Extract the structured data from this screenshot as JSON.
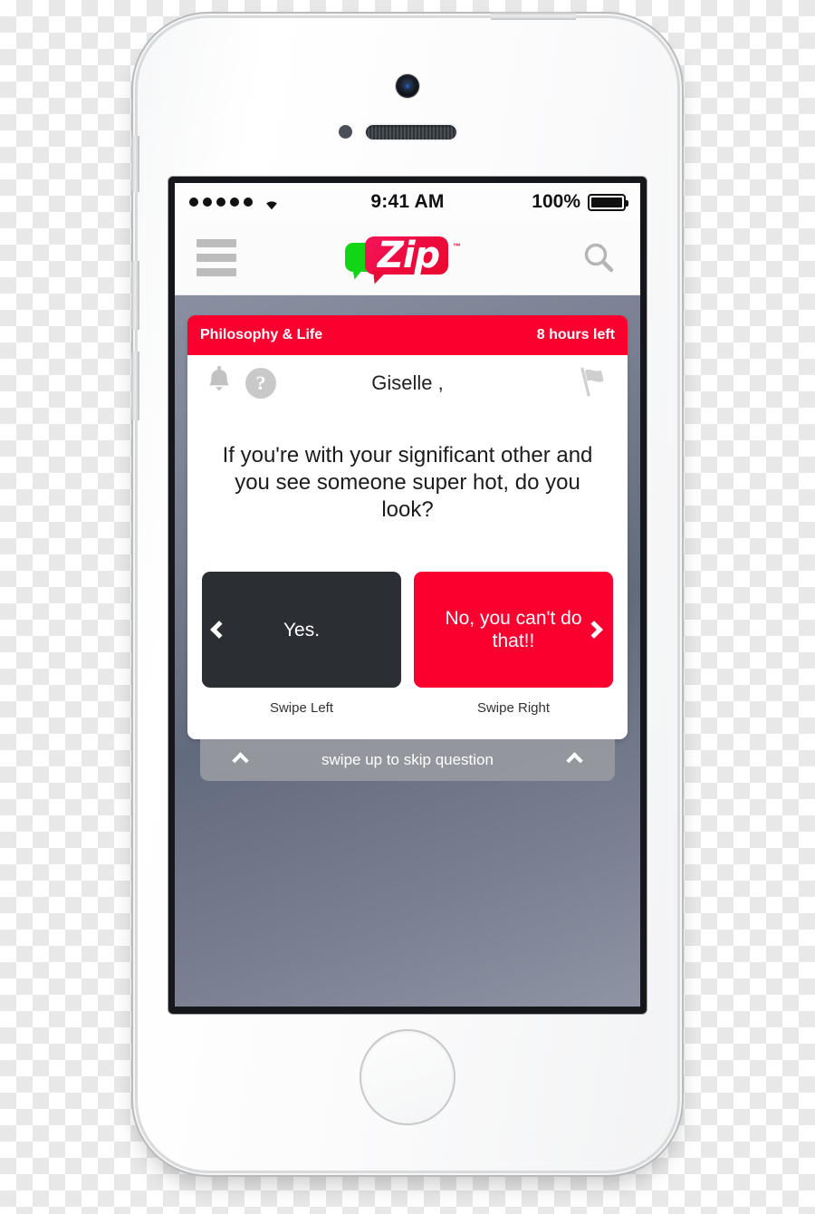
{
  "device": {
    "name": "iphone-5s-white",
    "icons": {
      "camera": "front-camera",
      "sensor": "proximity-sensor",
      "speaker": "earpiece-speaker",
      "home": "home-button",
      "power": "power-button",
      "mute": "mute-switch",
      "volume_up": "volume-up-button",
      "volume_down": "volume-down-button"
    }
  },
  "status_bar": {
    "signal_dots": 5,
    "wifi_icon": "wifi-icon",
    "time": "9:41 AM",
    "battery_percent": "100%",
    "battery_icon": "battery-full-icon"
  },
  "nav_bar": {
    "menu_icon": "hamburger-menu-icon",
    "logo_text": "Zip",
    "logo_tm": "™",
    "search_icon": "search-icon"
  },
  "card": {
    "category": "Philosophy & Life",
    "time_left": "8 hours left",
    "toolbar": {
      "bell_icon": "bell-icon",
      "help_icon": "question-mark-icon",
      "help_glyph": "?",
      "username": "Giselle ,",
      "flag_icon": "flag-icon"
    },
    "question": "If you're with your significant other and you see someone super hot, do you look?",
    "answers": [
      {
        "label": "Yes.",
        "swipe_hint": "Swipe Left",
        "chevron": "chevron-left-icon"
      },
      {
        "label": "No, you can't do that!!",
        "swipe_hint": "Swipe Right",
        "chevron": "chevron-right-icon"
      }
    ],
    "skip": {
      "text": "swipe up to skip question",
      "chevron_left": "chevron-up-icon",
      "chevron_right": "chevron-up-icon"
    }
  },
  "colors": {
    "brand_red": "#f9002e",
    "logo_green": "#12d516",
    "answer_dark": "#2b2f33",
    "skip_bar": "#96999e",
    "screen_bg_top": "#9298a8",
    "screen_bg_mid": "#626a7d"
  }
}
